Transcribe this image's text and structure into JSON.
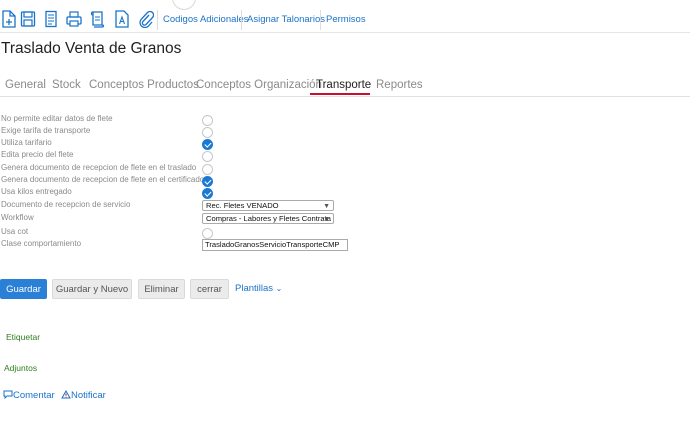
{
  "toolbar": {
    "icons": [
      "new-document-icon",
      "save-icon",
      "copy-document-icon",
      "print-icon",
      "report-icon",
      "text-document-icon",
      "attach-icon"
    ],
    "links": [
      "Codigos Adicionales",
      "Asignar Talonarios",
      "Permisos"
    ]
  },
  "page": {
    "title": "Traslado Venta de Granos"
  },
  "tabs": [
    "General",
    "Stock",
    "Conceptos Productos",
    "Conceptos Organización",
    "Transporte",
    "Reportes"
  ],
  "active_tab": "Transporte",
  "form": {
    "fields": [
      {
        "label": "No permite editar datos de flete",
        "type": "checkbox",
        "checked": false
      },
      {
        "label": "Exige tarifa de transporte",
        "type": "checkbox",
        "checked": false
      },
      {
        "label": "Utiliza tarifario",
        "type": "checkbox",
        "checked": true
      },
      {
        "label": "Edita precio del flete",
        "type": "checkbox",
        "checked": false
      },
      {
        "label": "Genera documento de recepcion de flete en el traslado",
        "type": "checkbox",
        "checked": false
      },
      {
        "label": "Genera documento de recepcion de flete en el certificado",
        "type": "checkbox",
        "checked": true
      },
      {
        "label": "Usa kilos entregado",
        "type": "checkbox",
        "checked": true
      },
      {
        "label": "Documento de recepcion de servicio",
        "type": "select",
        "value": "Rec. Fletes VENADO"
      },
      {
        "label": "Workflow",
        "type": "select",
        "value": "Compras - Labores y Fletes Contrata"
      },
      {
        "label": "Usa cot",
        "type": "checkbox",
        "checked": false
      },
      {
        "label": "Clase comportamiento",
        "type": "text",
        "value": "TrasladoGranosServicioTransporteCMP"
      }
    ]
  },
  "actions": {
    "guardar": "Guardar",
    "guardar_nuevo": "Guardar y Nuevo",
    "eliminar": "Eliminar",
    "cerrar": "cerrar",
    "plantillas": "Plantillas"
  },
  "sections": {
    "etiquetar": "Etiquetar",
    "adjuntos": "Adjuntos"
  },
  "footer": {
    "comentar": "Comentar",
    "notificar": "Notificar"
  },
  "colors": {
    "accent": "#2a7fd6",
    "link": "#1a73c9",
    "tab_active": "#c8102e",
    "section_green": "#2e7d1f"
  }
}
